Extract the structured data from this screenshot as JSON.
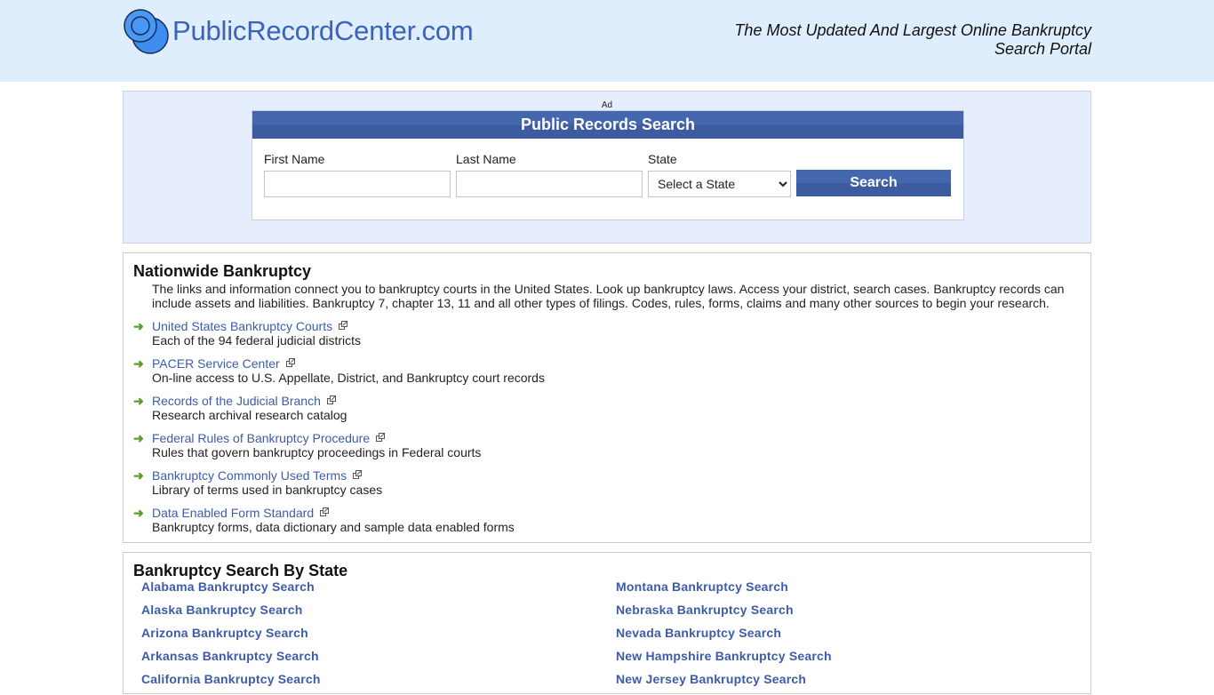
{
  "header": {
    "logo_text": "PublicRecordCenter.com",
    "tagline_line1": "The Most Updated And Largest Online Bankruptcy",
    "tagline_line2": "Search Portal"
  },
  "search": {
    "ad_label": "Ad",
    "title": "Public Records Search",
    "first_name_label": "First Name",
    "first_name_value": "",
    "last_name_label": "Last Name",
    "last_name_value": "",
    "state_label": "State",
    "state_selected": "Select a State",
    "button_label": "Search"
  },
  "nationwide": {
    "title": "Nationwide Bankruptcy",
    "intro": "The links and information connect you to bankruptcy courts in the United States. Look up bankruptcy laws. Access your district, search cases. Bankruptcy records can include assets and liabilities. Bankruptcy 7, chapter 13, 11 and all other types of filings. Codes, rules, forms, claims and many other sources to begin your research.",
    "links": [
      {
        "label": "United States Bankruptcy Courts",
        "description": "Each of the 94 federal judicial districts"
      },
      {
        "label": "PACER Service Center",
        "description": "On-line access to U.S. Appellate, District, and Bankruptcy court records"
      },
      {
        "label": "Records of the Judicial Branch",
        "description": "Research archival research catalog"
      },
      {
        "label": "Federal Rules of Bankruptcy Procedure",
        "description": "Rules that govern bankruptcy proceedings in Federal courts"
      },
      {
        "label": "Bankruptcy Commonly Used Terms",
        "description": "Library of terms used in bankruptcy cases"
      },
      {
        "label": "Data Enabled Form Standard",
        "description": "Bankruptcy forms, data dictionary and sample data enabled forms"
      }
    ]
  },
  "by_state": {
    "title": "Bankruptcy Search By State",
    "left_column": [
      "Alabama Bankruptcy Search",
      "Alaska Bankruptcy Search",
      "Arizona Bankruptcy Search",
      "Arkansas Bankruptcy Search",
      "California Bankruptcy Search"
    ],
    "right_column": [
      "Montana Bankruptcy Search",
      "Nebraska Bankruptcy Search",
      "Nevada Bankruptcy Search",
      "New Hampshire Bankruptcy Search",
      "New Jersey Bankruptcy Search"
    ]
  },
  "colors": {
    "header_bg": "#deeefc",
    "brand_blue": "#3d62b8",
    "link_blue": "#3d5ca8",
    "arrow_green": "#5a9e2f",
    "panel_bg": "#e6edfd"
  }
}
